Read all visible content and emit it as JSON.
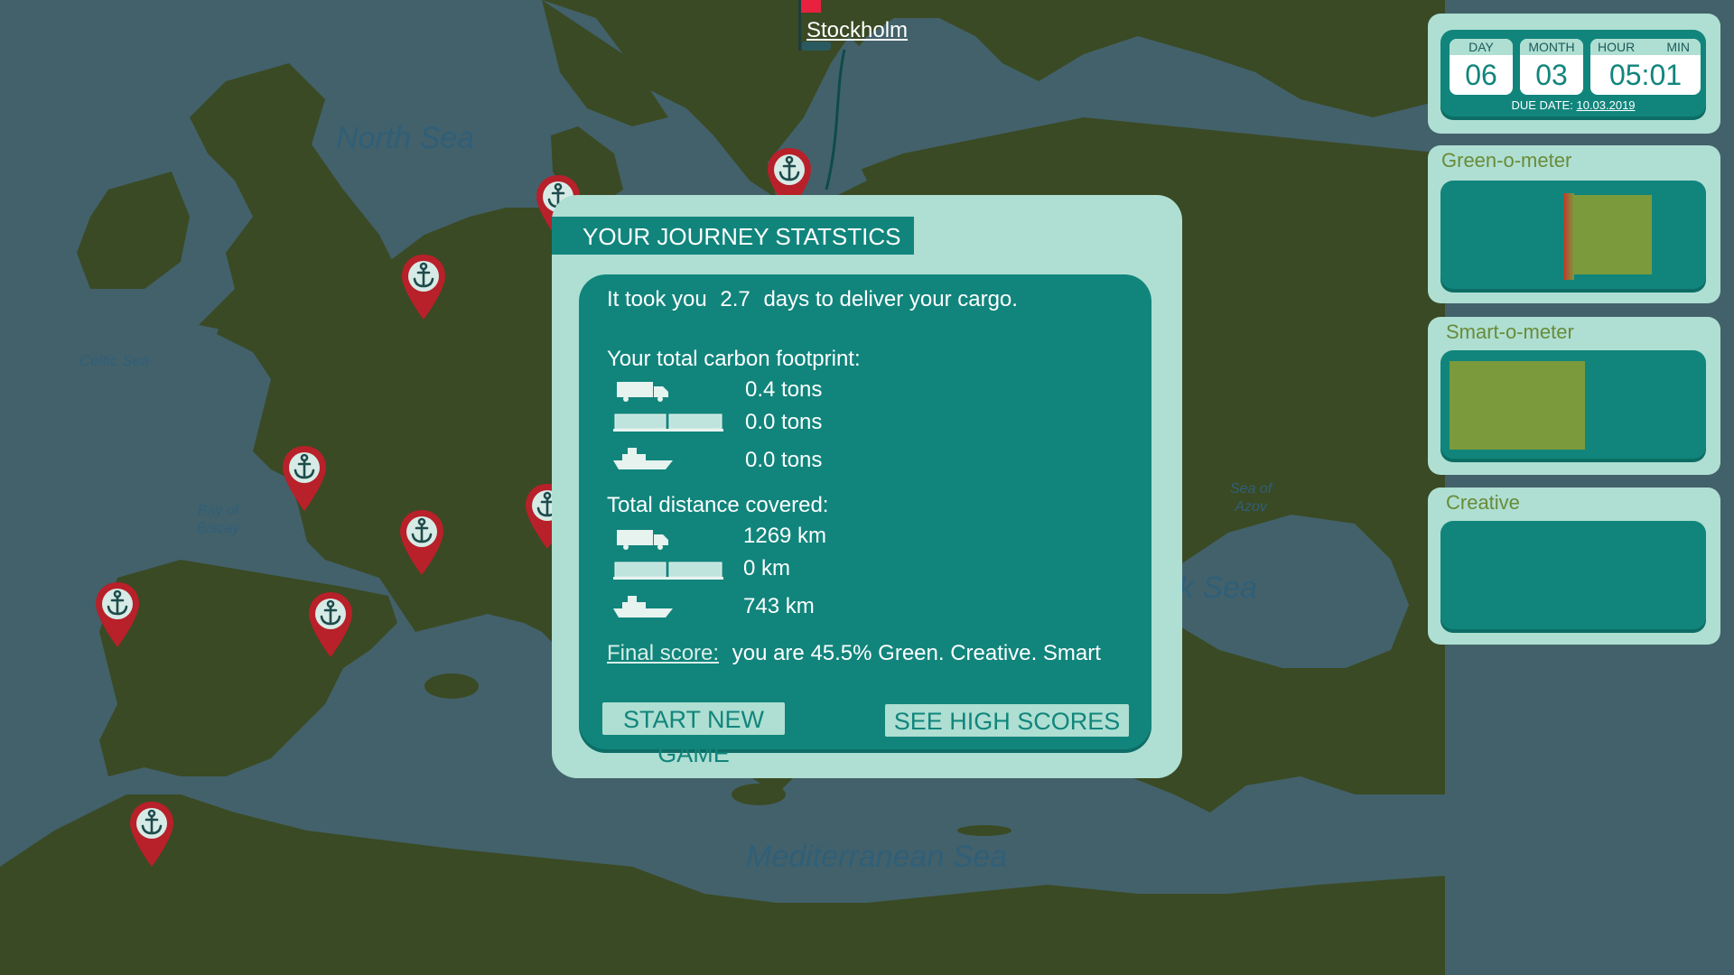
{
  "map": {
    "sea_labels": {
      "north_sea": "North Sea",
      "celtic_sea": "Celtic Sea",
      "bay_of_biscay_line1": "Bay of",
      "bay_of_biscay_line2": "Biscay",
      "mediterranean": "Mediterranean Sea",
      "sea_of_azov_line1": "Sea of",
      "sea_of_azov_line2": "Azov",
      "black_sea_partial": "k Sea"
    },
    "destination_city": "Stockholm",
    "colors": {
      "land": "#3a4a24",
      "sea": "#43616b",
      "pin": "#b8202a",
      "flag": "#e8213f"
    }
  },
  "clock": {
    "day_label": "DAY",
    "day_value": "06",
    "month_label": "MONTH",
    "month_value": "03",
    "hour_label": "HOUR",
    "min_label": "MIN",
    "hour_value": "05",
    "min_value": "01",
    "separator": ":",
    "due_label": "DUE DATE:",
    "due_value": "10.03.2019"
  },
  "meters": {
    "green": {
      "label": "Green-o-meter"
    },
    "smart": {
      "label": "Smart-o-meter"
    },
    "creative": {
      "label": "Creative"
    }
  },
  "modal": {
    "title": "YOUR JOURNEY STATSTICS",
    "took_prefix": "It took you",
    "days": "2.7",
    "took_suffix": "days to deliver your cargo.",
    "carbon_heading": "Your total carbon footprint:",
    "carbon": {
      "truck": "0.4 tons",
      "train": "0.0 tons",
      "ship": "0.0 tons"
    },
    "distance_heading": "Total distance covered:",
    "distance": {
      "truck": "1269 km",
      "train": "0 km",
      "ship": "743 km"
    },
    "final_score_label": "Final score:",
    "final_score_text": "you are 45.5% Green. Creative. Smart",
    "buttons": {
      "new_game": "START NEW GAME",
      "high_scores": "SEE HIGH SCORES"
    }
  },
  "colors": {
    "panel_light": "#aedfd2",
    "panel_dark": "#11857c",
    "meter_fill": "#7b9a3c",
    "meter_edge": "#c0392b"
  }
}
